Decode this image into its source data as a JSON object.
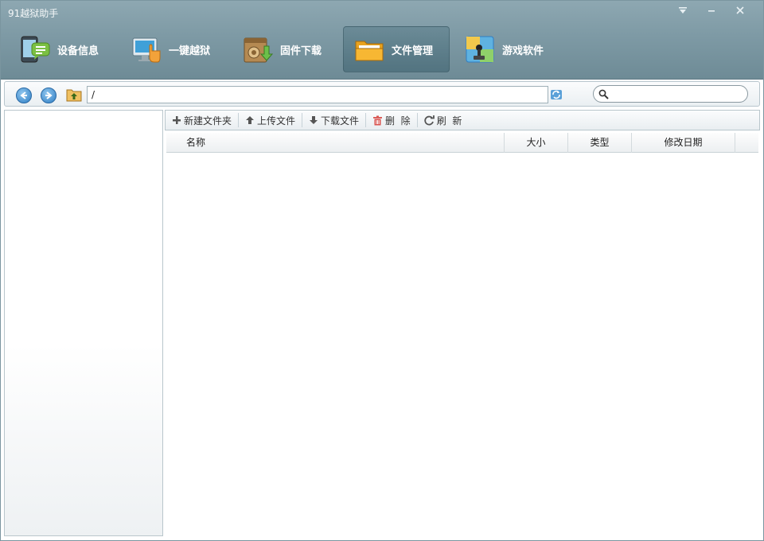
{
  "window": {
    "title": "91越狱助手",
    "menu_icon": "dropdown-arrow-icon",
    "min_icon": "minimize-icon",
    "close_icon": "close-icon"
  },
  "nav": {
    "tabs": [
      {
        "label": "设备信息",
        "icon": "device-info-icon",
        "active": false
      },
      {
        "label": "一键越狱",
        "icon": "jailbreak-icon",
        "active": false
      },
      {
        "label": "固件下载",
        "icon": "firmware-download-icon",
        "active": false
      },
      {
        "label": "文件管理",
        "icon": "folder-icon",
        "active": true
      },
      {
        "label": "游戏软件",
        "icon": "games-apps-icon",
        "active": false
      }
    ]
  },
  "address": {
    "path": "/",
    "search_placeholder": ""
  },
  "toolbar": {
    "new_folder": "新建文件夹",
    "upload": "上传文件",
    "download": "下载文件",
    "delete": "删  除",
    "refresh": "刷  新"
  },
  "file_list": {
    "columns": [
      "名称",
      "大小",
      "类型",
      "修改日期"
    ],
    "rows": []
  },
  "colors": {
    "header_bg": "#7e9aa5",
    "accent_blue": "#2f7ec4",
    "delete_red": "#d9534f"
  }
}
